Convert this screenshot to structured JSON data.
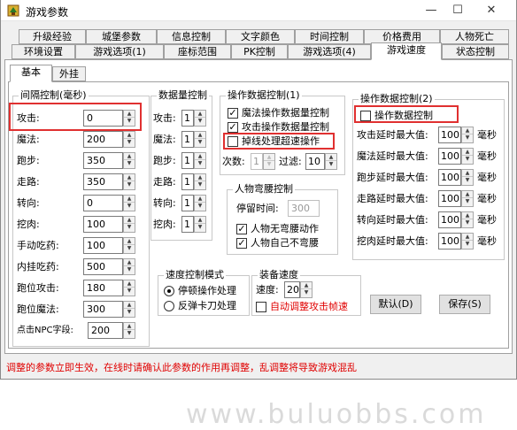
{
  "window": {
    "title": "游戏参数",
    "min": "—",
    "max": "☐",
    "close": "✕"
  },
  "tabs_row1": [
    "升级经验",
    "城堡参数",
    "信息控制",
    "文字颜色",
    "时间控制",
    "价格费用",
    "人物死亡"
  ],
  "tabs_row2": [
    "环境设置",
    "游戏选项(1)",
    "座标范围",
    "PK控制",
    "游戏选项(4)",
    "游戏速度",
    "状态控制"
  ],
  "subtabs": [
    "基本",
    "外挂"
  ],
  "interval": {
    "title": "间隔控制(毫秒)",
    "rows": [
      {
        "label": "攻击:",
        "value": "0"
      },
      {
        "label": "魔法:",
        "value": "200"
      },
      {
        "label": "跑步:",
        "value": "350"
      },
      {
        "label": "走路:",
        "value": "350"
      },
      {
        "label": "转向:",
        "value": "0"
      },
      {
        "label": "挖肉:",
        "value": "100"
      },
      {
        "label": "手动吃药:",
        "value": "100"
      },
      {
        "label": "内挂吃药:",
        "value": "500"
      },
      {
        "label": "跑位攻击:",
        "value": "180"
      },
      {
        "label": "跑位魔法:",
        "value": "300"
      },
      {
        "label": "点击NPC字段:",
        "value": "200"
      }
    ]
  },
  "quantity": {
    "title": "数据量控制",
    "rows": [
      {
        "label": "攻击:",
        "value": "1"
      },
      {
        "label": "魔法:",
        "value": "1"
      },
      {
        "label": "跑步:",
        "value": "1"
      },
      {
        "label": "走路:",
        "value": "1"
      },
      {
        "label": "转向:",
        "value": "1"
      },
      {
        "label": "挖肉:",
        "value": "1"
      }
    ]
  },
  "opdata1": {
    "title": "操作数据控制(1)",
    "checks": [
      {
        "label": "魔法操作数据量控制",
        "checked": "✓"
      },
      {
        "label": "攻击操作数据量控制",
        "checked": "✓"
      },
      {
        "label": "掉线处理超速操作",
        "checked": ""
      }
    ],
    "count_label": "次数:",
    "count_value": "1",
    "filter_label": "过滤:",
    "filter_value": "10"
  },
  "bend": {
    "title": "人物弯腰控制",
    "stay_label": "停留时间:",
    "stay_value": "300",
    "checks": [
      {
        "label": "人物无弯腰动作",
        "checked": "✓"
      },
      {
        "label": "人物自己不弯腰",
        "checked": "✓"
      }
    ]
  },
  "opdata2": {
    "title": "操作数据控制(2)",
    "check_label": "操作数据控制",
    "check_state": "",
    "unit": "毫秒",
    "rows": [
      {
        "label": "攻击延时最大值:",
        "value": "100"
      },
      {
        "label": "魔法延时最大值:",
        "value": "100"
      },
      {
        "label": "跑步延时最大值:",
        "value": "100"
      },
      {
        "label": "走路延时最大值:",
        "value": "100"
      },
      {
        "label": "转向延时最大值:",
        "value": "100"
      },
      {
        "label": "挖肉延时最大值:",
        "value": "100"
      }
    ]
  },
  "speed_mode": {
    "title": "速度控制模式",
    "options": [
      "停顿操作处理",
      "反弹卡刀处理"
    ]
  },
  "equip_speed": {
    "title": "装备速度",
    "speed_label": "速度:",
    "speed_value": "20",
    "auto_label": "自动调整攻击帧速"
  },
  "buttons": {
    "default": "默认(D)",
    "save": "保存(S)"
  },
  "watermark": "www.buluobbs.com",
  "status": "调整的参数立即生效，在线时请确认此参数的作用再调整，乱调整将导致游戏混乱",
  "colors": {
    "accent_red": "#e03030",
    "status_red": "#e00000"
  }
}
